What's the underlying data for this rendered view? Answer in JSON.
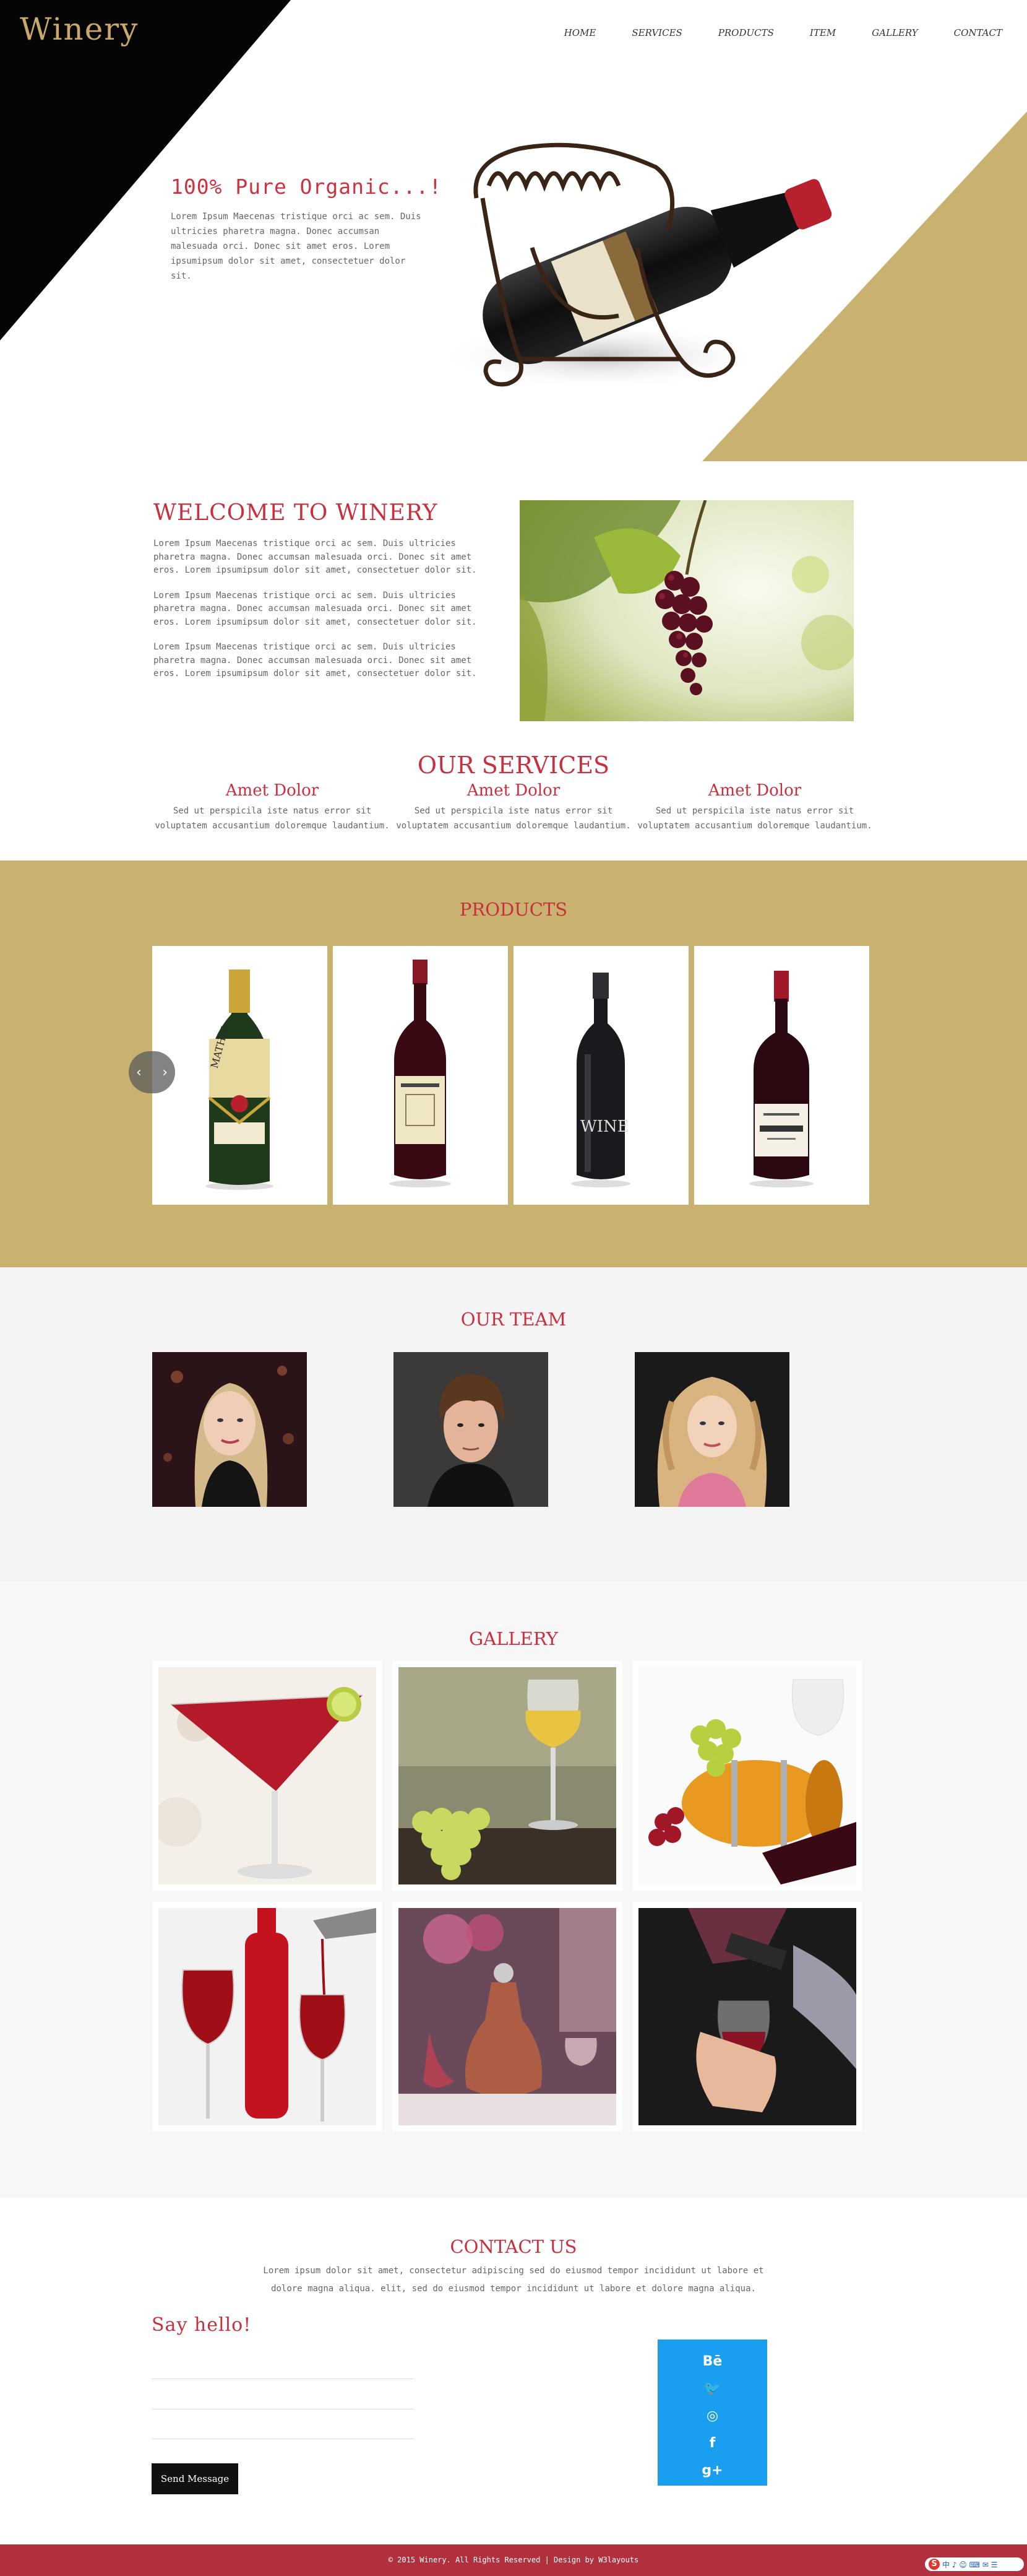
{
  "brand": {
    "logo": "Winery"
  },
  "nav": [
    "HOME",
    "SERVICES",
    "PRODUCTS",
    "ITEM",
    "GALLERY",
    "CONTACT"
  ],
  "hero": {
    "title": "100% Pure Organic...!",
    "text": "Lorem Ipsum Maecenas tristique orci ac sem. Duis ultricies pharetra magna. Donec accumsan malesuada orci. Donec sit amet eros. Lorem ipsumipsum dolor sit amet, consectetuer dolor sit."
  },
  "welcome": {
    "title": "WELCOME TO WINERY",
    "paragraphs": [
      "Lorem Ipsum Maecenas tristique orci ac sem. Duis ultricies pharetra magna. Donec accumsan malesuada orci. Donec sit amet eros. Lorem ipsumipsum dolor sit amet, consectetuer dolor sit.",
      "Lorem Ipsum Maecenas tristique orci ac sem. Duis ultricies pharetra magna. Donec accumsan malesuada orci. Donec sit amet eros. Lorem ipsumipsum dolor sit amet, consectetuer dolor sit.",
      "Lorem Ipsum Maecenas tristique orci ac sem. Duis ultricies pharetra magna. Donec accumsan malesuada orci. Donec sit amet eros. Lorem ipsumipsum dolor sit amet, consectetuer dolor sit."
    ]
  },
  "services": {
    "title": "OUR SERVICES",
    "items": [
      {
        "title": "Amet Dolor",
        "text": "Sed ut perspicila iste natus error sit voluptatem accusantium doloremque laudantium."
      },
      {
        "title": "Amet Dolor",
        "text": "Sed ut perspicila iste natus error sit voluptatem accusantium doloremque laudantium."
      },
      {
        "title": "Amet Dolor",
        "text": "Sed ut perspicila iste natus error sit voluptatem accusantium doloremque laudantium."
      }
    ]
  },
  "products": {
    "title": "PRODUCTS",
    "labels": [
      "MATHIE",
      "WINE"
    ],
    "prev_icon": "chevron-left-icon",
    "next_icon": "chevron-right-icon"
  },
  "team": {
    "title": "OUR TEAM"
  },
  "gallery": {
    "title": "GALLERY"
  },
  "contact": {
    "title": "CONTACT US",
    "text": "Lorem ipsum dolor sit amet, consectetur adipiscing sed do eiusmod tempor incididunt ut labore et dolore magna aliqua. elit, sed do eiusmod tempor incididunt ut labore et dolore magna aliqua.",
    "say_hello": "Say hello!",
    "send_label": "Send Message",
    "social": [
      "Bē",
      "🐦",
      "◎",
      "f",
      "g+"
    ]
  },
  "footer": {
    "text": "© 2015 Winery. All Rights Reserved | Design by W3layouts"
  },
  "ime": {
    "badge": "S",
    "text": "中 ♪ ☺ ⌨ ✉ ☰"
  },
  "colors": {
    "accent_red": "#c9303e",
    "gold": "#c9b270",
    "footer_red": "#b1303e",
    "social_blue": "#1a9ff0"
  }
}
